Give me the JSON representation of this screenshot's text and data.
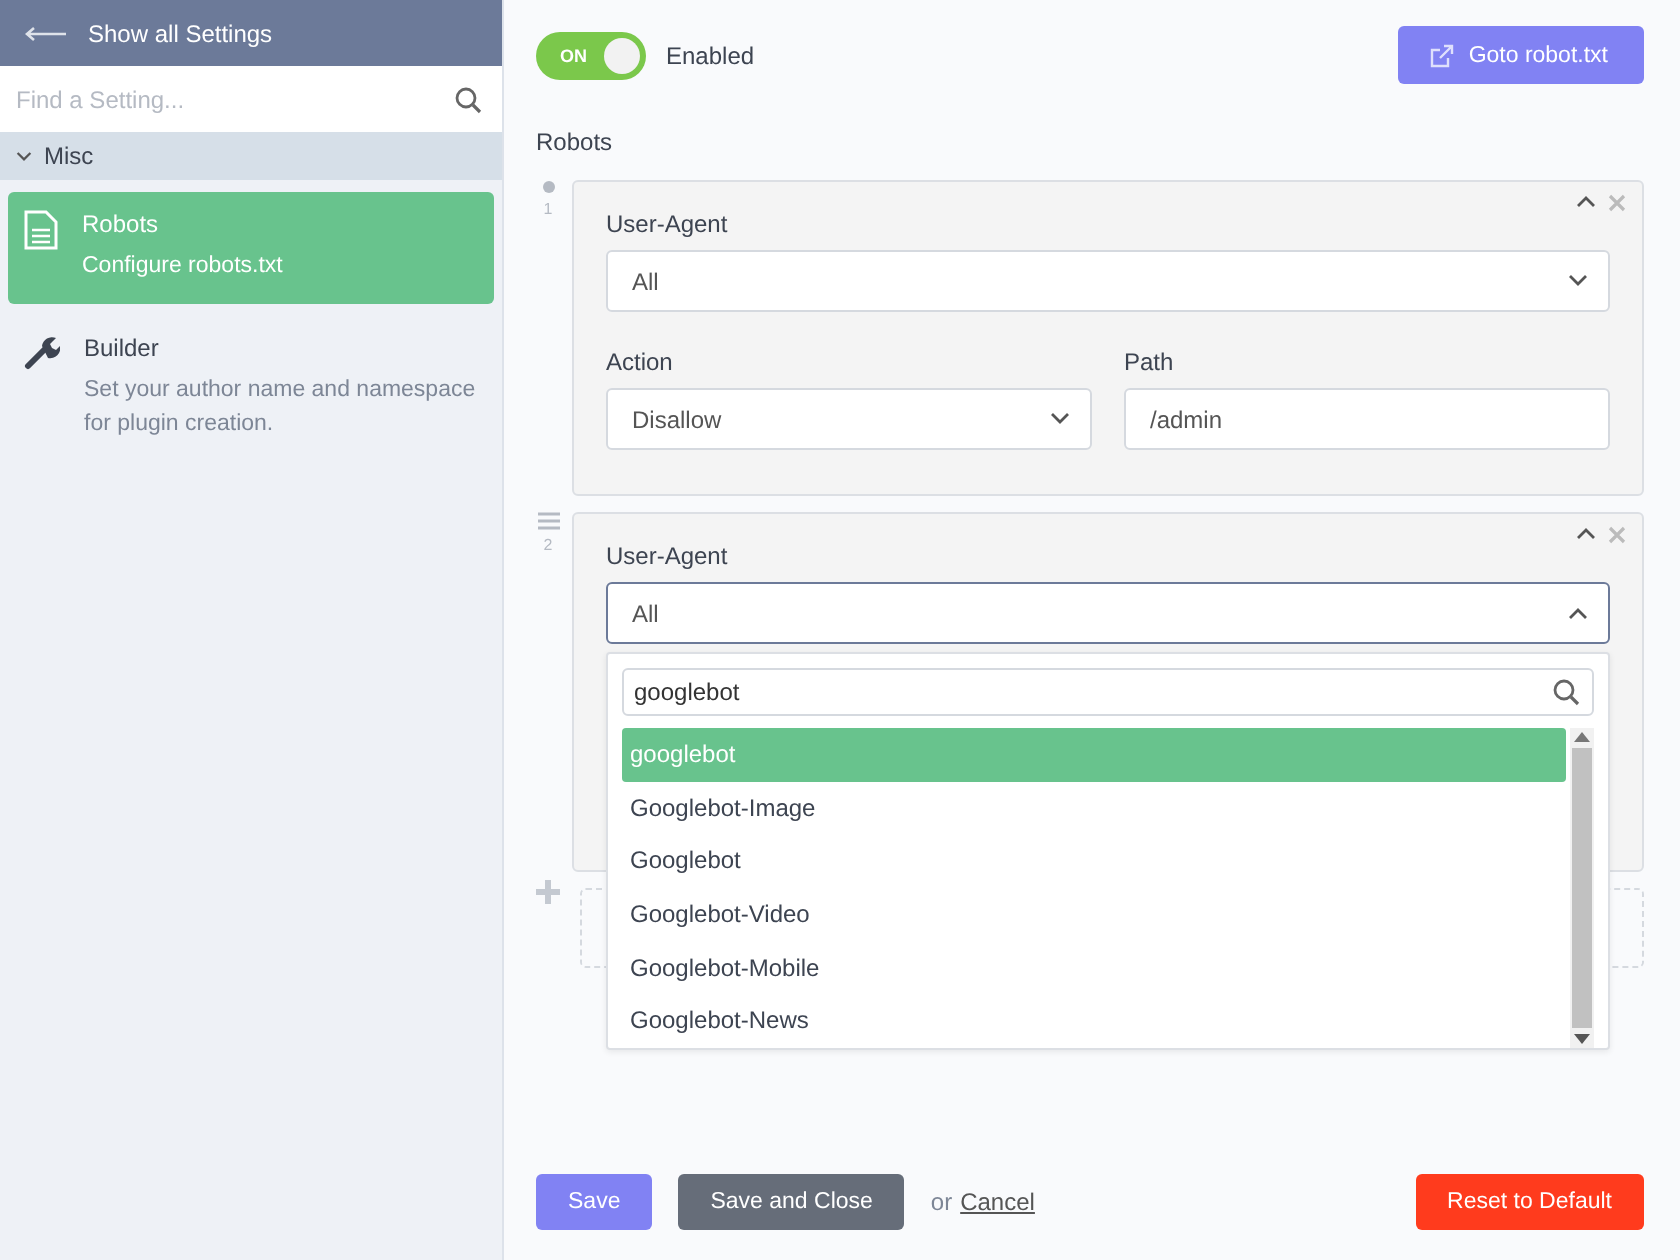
{
  "sidebar": {
    "back": "Show all Settings",
    "search": {
      "placeholder": "Find a Setting..."
    },
    "groups": [
      {
        "label": "Misc",
        "expanded": true,
        "items": [
          {
            "kind": "document",
            "title": "Robots",
            "description": "Configure robots.txt",
            "selected": true
          },
          {
            "kind": "wrench",
            "title": "Builder",
            "description": "Set your author name and namespace for plugin creation.",
            "selected": false
          }
        ]
      }
    ]
  },
  "header": {
    "toggle": {
      "label": "ON",
      "on": true,
      "text": "Enabled"
    },
    "goto_button": "Goto robot.txt"
  },
  "section_label": "Robots",
  "rules": [
    {
      "number": "1",
      "kind": "dot",
      "user_agent_label": "User-Agent",
      "user_agent": "All",
      "open": false,
      "action_label": "Action",
      "action": "Disallow",
      "path_label": "Path",
      "path": "/admin"
    },
    {
      "number": "2",
      "kind": "lines",
      "user_agent_label": "User-Agent",
      "user_agent": "All",
      "open": true,
      "dropdown": {
        "search": "googlebot",
        "options": [
          {
            "label": "googlebot",
            "selected": true
          },
          {
            "label": "Googlebot-Image",
            "selected": false
          },
          {
            "label": "Googlebot",
            "selected": false
          },
          {
            "label": "Googlebot-Video",
            "selected": false
          },
          {
            "label": "Googlebot-Mobile",
            "selected": false
          },
          {
            "label": "Googlebot-News",
            "selected": false
          }
        ]
      }
    }
  ],
  "footer": {
    "save": "Save",
    "save_close": "Save and Close",
    "or": "or",
    "cancel": "Cancel",
    "reset": "Reset to Default"
  }
}
